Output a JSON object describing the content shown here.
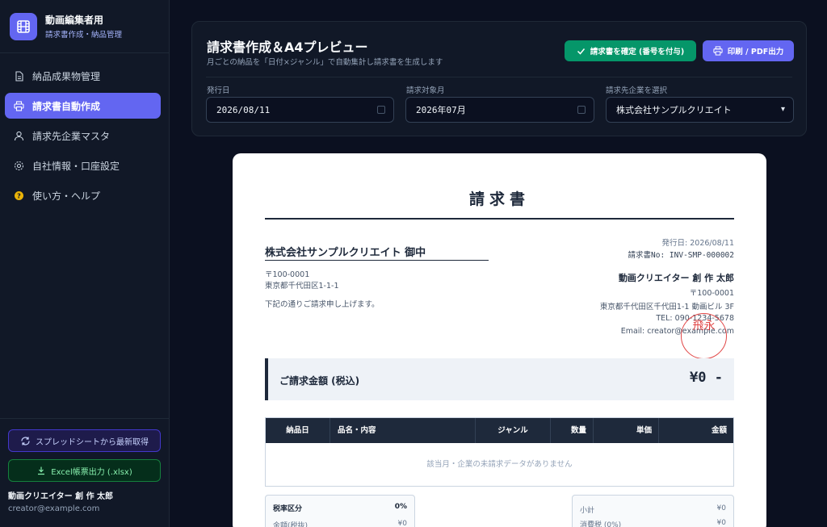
{
  "brand": {
    "title": "動画編集者用",
    "subtitle": "請求書作成・納品管理"
  },
  "nav": {
    "items": [
      {
        "label": "納品成果物管理",
        "icon": "document-icon"
      },
      {
        "label": "請求書自動作成",
        "icon": "printer-icon",
        "active": true
      },
      {
        "label": "請求先企業マスタ",
        "icon": "user-icon"
      },
      {
        "label": "自社情報・口座設定",
        "icon": "gear-icon"
      },
      {
        "label": "使い方・ヘルプ",
        "icon": "help-icon"
      }
    ]
  },
  "sidebar_bottom": {
    "sync_label": "スプレッドシートから最新取得",
    "excel_label": "Excel帳票出力 (.xlsx)",
    "user_name": "動画クリエイター 創 作 太郎",
    "user_email": "creator@example.com"
  },
  "panel": {
    "title": "請求書作成＆A4プレビュー",
    "description": "月ごとの納品を「日付×ジャンル」で自動集計し請求書を生成します",
    "confirm_label": "請求書を確定 (番号を付与)",
    "print_label": "印刷 / PDF出力",
    "issue_date_label": "発行日",
    "issue_date_value": "2026/08/11",
    "target_month_label": "請求対象月",
    "target_month_value": "2026年07月",
    "client_select_label": "請求先企業を選択",
    "client_select_value": "株式会社サンプルクリエイト"
  },
  "invoice": {
    "title": "請求書",
    "client_name": "株式会社サンプルクリエイト 御中",
    "client_postal": "〒100-0001",
    "client_address": "東京都千代田区1-1-1",
    "greeting": "下記の通りご請求申し上げます。",
    "issue_date": "発行日: 2026/08/11",
    "invoice_no": "請求書No: INV-SMP-000002",
    "issuer_name": "動画クリエイター 創 作 太郎",
    "issuer_postal": "〒100-0001",
    "issuer_address": "東京都千代田区千代田1-1 動画ビル 3F",
    "issuer_tel": "TEL: 090-1234-5678",
    "issuer_email": "Email: creator@example.com",
    "stamp_text": "飛永",
    "total_label": "ご請求金額 (税込)",
    "total_value": "¥0 -",
    "columns": [
      "納品日",
      "品名・内容",
      "ジャンル",
      "数量",
      "単価",
      "金額"
    ],
    "empty_message": "該当月・企業の未請求データがありません",
    "tax_box": {
      "header_label": "税率区分",
      "header_value": "0%",
      "row_label": "金額(税抜)",
      "row_value": "¥0"
    },
    "sum_box": {
      "subtotal_label": "小計",
      "subtotal_value": "¥0",
      "tax_label": "消費税 (0%)",
      "tax_value": "¥0"
    }
  },
  "colors": {
    "accent": "#6366f1",
    "confirm": "#059669",
    "stamp": "#dc2626"
  }
}
